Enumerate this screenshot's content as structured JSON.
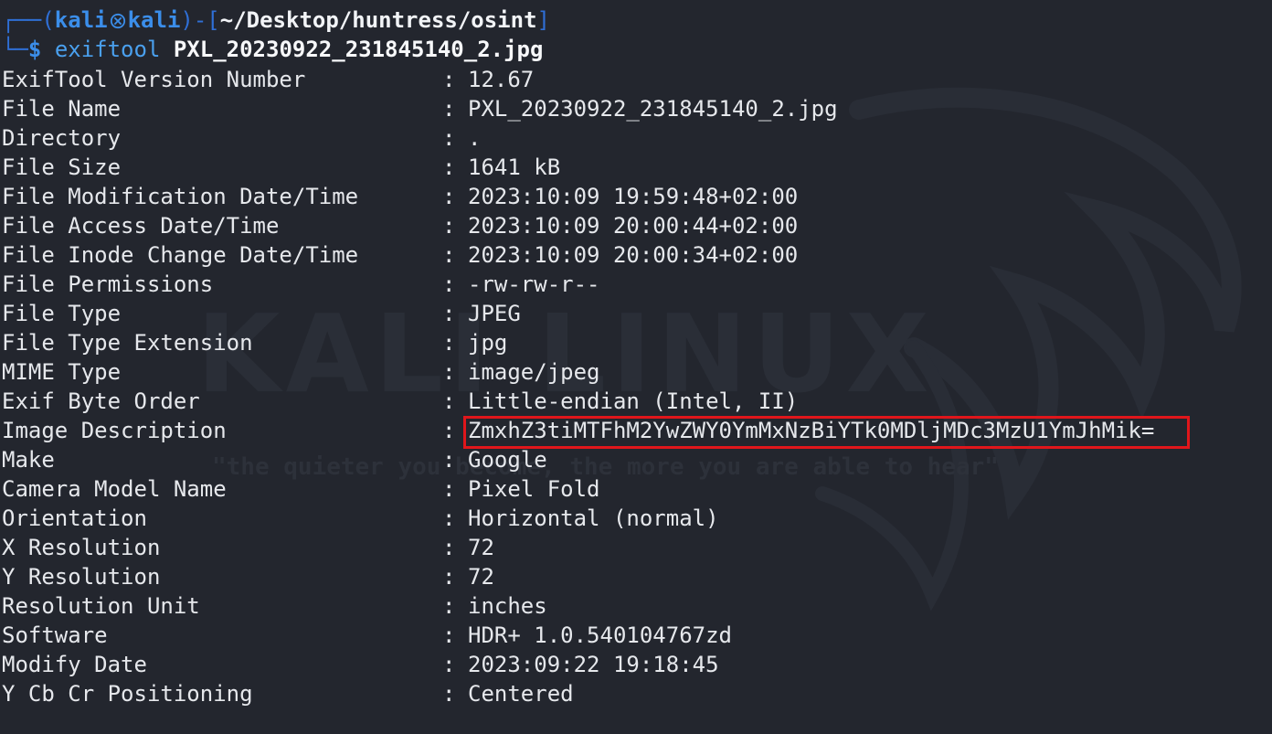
{
  "prompt": {
    "user": "kali",
    "host": "kali",
    "path": "~/Desktop/huntress/osint",
    "dollar": "$",
    "command": "exiftool",
    "argument": "PXL_20230922_231845140_2.jpg"
  },
  "watermark": {
    "title": "KALI LINUX",
    "quote": "\"the quieter you become, the more you are able to hear\""
  },
  "colors": {
    "background": "#23262e",
    "prompt_blue": "#3b8eea",
    "highlight_red": "#e0161b"
  },
  "highlighted_row": "Image Description",
  "output": [
    {
      "key": "ExifTool Version Number",
      "value": "12.67"
    },
    {
      "key": "File Name",
      "value": "PXL_20230922_231845140_2.jpg"
    },
    {
      "key": "Directory",
      "value": "."
    },
    {
      "key": "File Size",
      "value": "1641 kB"
    },
    {
      "key": "File Modification Date/Time",
      "value": "2023:10:09 19:59:48+02:00"
    },
    {
      "key": "File Access Date/Time",
      "value": "2023:10:09 20:00:44+02:00"
    },
    {
      "key": "File Inode Change Date/Time",
      "value": "2023:10:09 20:00:34+02:00"
    },
    {
      "key": "File Permissions",
      "value": "-rw-rw-r--"
    },
    {
      "key": "File Type",
      "value": "JPEG"
    },
    {
      "key": "File Type Extension",
      "value": "jpg"
    },
    {
      "key": "MIME Type",
      "value": "image/jpeg"
    },
    {
      "key": "Exif Byte Order",
      "value": "Little-endian (Intel, II)"
    },
    {
      "key": "Image Description",
      "value": "ZmxhZ3tiMTFhM2YwZWY0YmMxNzBiYTk0MDljMDc3MzU1YmJhMik="
    },
    {
      "key": "Make",
      "value": "Google"
    },
    {
      "key": "Camera Model Name",
      "value": "Pixel Fold"
    },
    {
      "key": "Orientation",
      "value": "Horizontal (normal)"
    },
    {
      "key": "X Resolution",
      "value": "72"
    },
    {
      "key": "Y Resolution",
      "value": "72"
    },
    {
      "key": "Resolution Unit",
      "value": "inches"
    },
    {
      "key": "Software",
      "value": "HDR+ 1.0.540104767zd"
    },
    {
      "key": "Modify Date",
      "value": "2023:09:22 19:18:45"
    },
    {
      "key": "Y Cb Cr Positioning",
      "value": "Centered"
    }
  ]
}
